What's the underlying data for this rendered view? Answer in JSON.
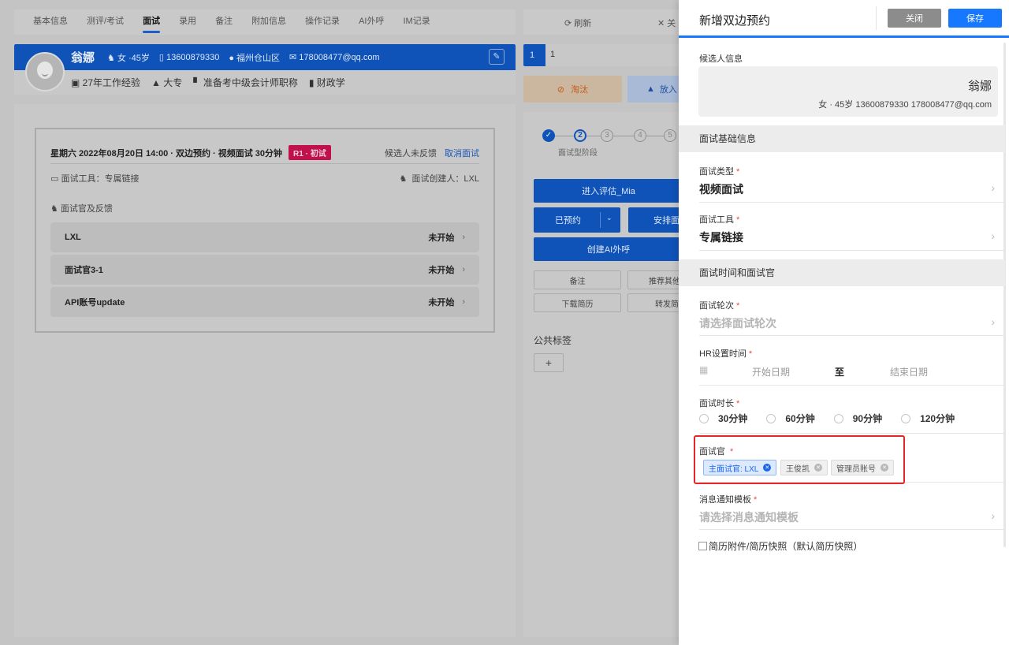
{
  "left_tabs": [
    "基本信息",
    "测评/考试",
    "面试",
    "录用",
    "备注",
    "附加信息",
    "操作记录",
    "AI外呼",
    "IM记录"
  ],
  "profile": {
    "name": "翁娜",
    "gender_age": "女 ·45岁",
    "phone": "13600879330",
    "location": "福州仓山区",
    "email": "178008477@qq.com",
    "experience": "27年工作经验",
    "education": "大专",
    "certificate": "准备考中级会计师职称",
    "major": "财政学"
  },
  "interview_card": {
    "summary": "星期六 2022年08月20日 14:00 · 双边预约 · 视频面试 30分钟",
    "round_badge": "R1 · 初试",
    "feedback_status": "候选人未反馈",
    "cancel_link": "取消面试",
    "tool": "面试工具：专属链接",
    "creator": "面试创建人：LXL",
    "interviewers_title": "面试官及反馈",
    "interviewers": [
      {
        "name": "LXL",
        "status": "未开始"
      },
      {
        "name": "面试官3-1",
        "status": "未开始"
      },
      {
        "name": "API账号update",
        "status": "未开始"
      }
    ]
  },
  "middle": {
    "refresh": "刷新",
    "close_partial": "关",
    "input_index": "1",
    "input_value": "1",
    "reject": "淘汰",
    "pool": "放入",
    "steps": [
      "2",
      "3",
      "4",
      "5"
    ],
    "stage_label": "面试型阶段",
    "evaluate": "进入评估_Mia",
    "booked": "已预约",
    "arrange": "安排面",
    "create_ai_call": "创建AI外呼",
    "note": "备注",
    "recommend": "推荐其他",
    "download_resume": "下载简历",
    "forward": "转发简",
    "public_tags": "公共标签",
    "add": "+"
  },
  "drawer": {
    "title": "新增双边预约",
    "close": "关闭",
    "save": "保存",
    "candidate_section": "候选人信息",
    "candidate_name": "翁娜",
    "candidate_meta": "女 · 45岁   13600879330   178008477@qq.com",
    "basic_group": "面试基础信息",
    "type_label": "面试类型",
    "type_value": "视频面试",
    "tool_label": "面试工具",
    "tool_value": "专属链接",
    "time_group": "面试时间和面试官",
    "round_label": "面试轮次",
    "round_placeholder": "请选择面试轮次",
    "hr_time_label": "HR设置时间",
    "start_date": "开始日期",
    "to": "至",
    "end_date": "结束日期",
    "duration_label": "面试时长",
    "durations": [
      "30分钟",
      "60分钟",
      "90分钟",
      "120分钟"
    ],
    "interviewer_label": "面试官",
    "interviewers": [
      "主面试官: LXL",
      "王俊凯",
      "管理员账号"
    ],
    "template_label": "消息通知模板",
    "template_placeholder": "请选择消息通知模板",
    "attachment_option": "简历附件/简历快照（默认简历快照）"
  },
  "colors": {
    "primary": "#1677ff",
    "required": "#e34d4d",
    "highlight": "#e5252a"
  }
}
